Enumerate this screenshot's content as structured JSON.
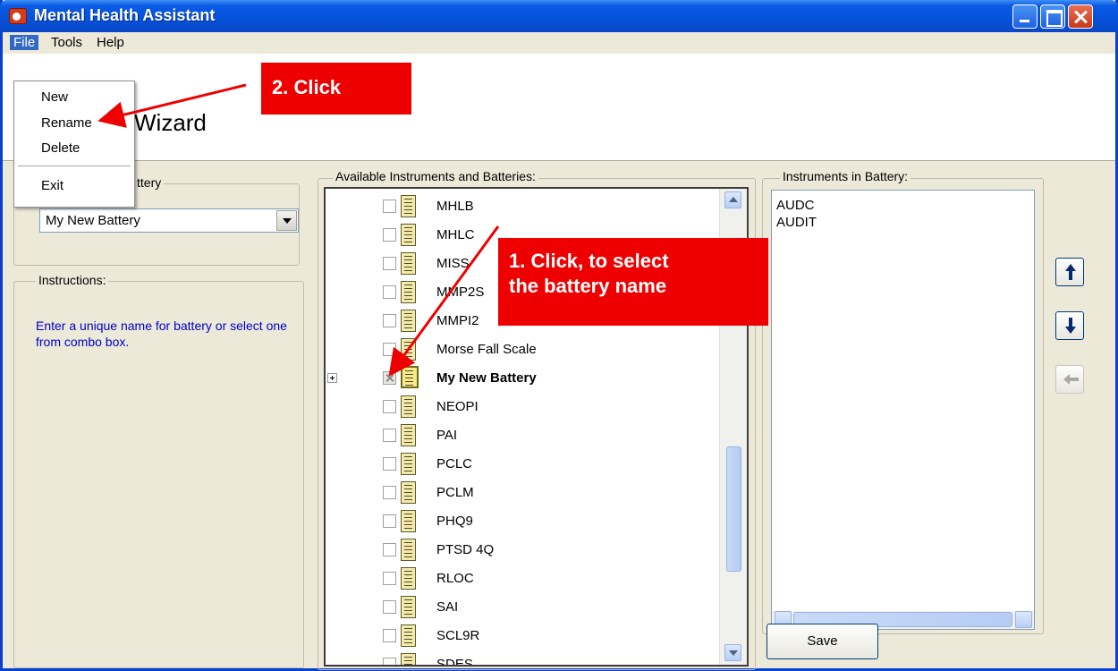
{
  "window": {
    "title": "Mental Health Assistant"
  },
  "menubar": {
    "items": [
      "File",
      "Tools",
      "Help"
    ]
  },
  "file_menu": {
    "items": [
      "New",
      "Rename",
      "Delete",
      "Exit"
    ]
  },
  "header": {
    "title_partial": "Wizard"
  },
  "left_panel": {
    "battery_group_label_partial": "ttery",
    "battery_combo_value": "My New Battery",
    "instructions_label": "Instructions:",
    "instructions_text": "Enter a unique name for battery or select one from combo box."
  },
  "available": {
    "label": "Available Instruments and Batteries:",
    "items": [
      {
        "label": "MHLB",
        "checked": false,
        "bold": false
      },
      {
        "label": "MHLC",
        "checked": false,
        "bold": false
      },
      {
        "label": "MISS",
        "checked": false,
        "bold": false
      },
      {
        "label": "MMP2S",
        "checked": false,
        "bold": false
      },
      {
        "label": "MMPI2",
        "checked": false,
        "bold": false
      },
      {
        "label": "Morse Fall Scale",
        "checked": false,
        "bold": false
      },
      {
        "label": "My New Battery",
        "checked": "partial",
        "bold": true
      },
      {
        "label": "NEOPI",
        "checked": false,
        "bold": false
      },
      {
        "label": "PAI",
        "checked": false,
        "bold": false
      },
      {
        "label": "PCLC",
        "checked": false,
        "bold": false
      },
      {
        "label": "PCLM",
        "checked": false,
        "bold": false
      },
      {
        "label": "PHQ9",
        "checked": false,
        "bold": false
      },
      {
        "label": "PTSD 4Q",
        "checked": false,
        "bold": false
      },
      {
        "label": "RLOC",
        "checked": false,
        "bold": false
      },
      {
        "label": "SAI",
        "checked": false,
        "bold": false
      },
      {
        "label": "SCL9R",
        "checked": false,
        "bold": false
      },
      {
        "label": "SDES",
        "checked": false,
        "bold": false
      }
    ]
  },
  "in_battery": {
    "label": "Instruments in Battery:",
    "items": [
      "AUDC",
      "AUDIT"
    ]
  },
  "buttons": {
    "save": "Save"
  },
  "callouts": {
    "step1_line1": "1. Click, to select",
    "step1_line2": "the battery name",
    "step2": "2. Click"
  },
  "colors": {
    "titlebar": "#0552d9",
    "dialog_bg": "#ece9d8",
    "callout": "#ee0000",
    "instructions_text": "#0000c8"
  }
}
